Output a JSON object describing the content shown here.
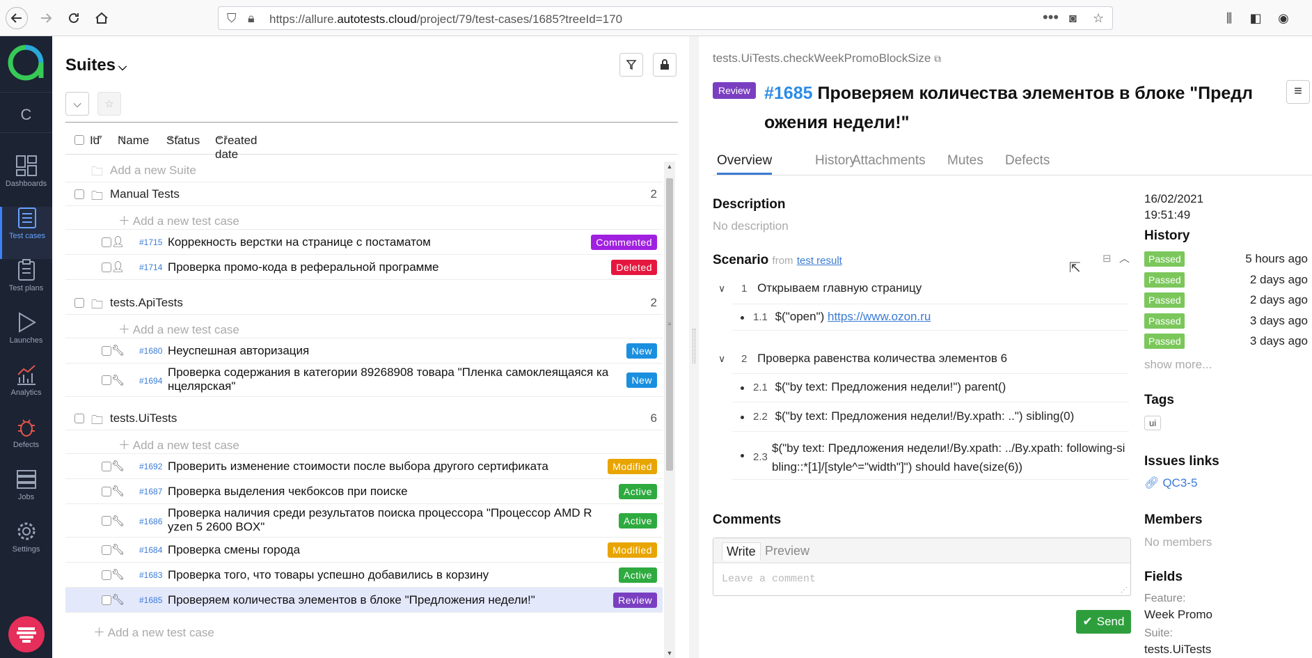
{
  "browser": {
    "url_prefix": "https://allure.",
    "url_host": "autotests.cloud",
    "url_suffix": "/project/79/test-cases/1685?treeId=170"
  },
  "nav": {
    "project_letter": "C",
    "items": [
      {
        "label": "Dashboards",
        "icon": "dashboards-icon"
      },
      {
        "label": "Test cases",
        "icon": "test-cases-icon"
      },
      {
        "label": "Test plans",
        "icon": "test-plans-icon"
      },
      {
        "label": "Launches",
        "icon": "launches-icon"
      },
      {
        "label": "Analytics",
        "icon": "analytics-icon"
      },
      {
        "label": "Defects",
        "icon": "defects-icon"
      },
      {
        "label": "Jobs",
        "icon": "jobs-icon"
      },
      {
        "label": "Settings",
        "icon": "settings-icon"
      }
    ],
    "active": "Test cases"
  },
  "left": {
    "title": "Suites",
    "columns": {
      "id": "Id",
      "name": "Name",
      "status": "Status",
      "created": "Created date"
    },
    "add_suite": "Add a new Suite",
    "add_case": "Add a new test case",
    "suites": [
      {
        "name": "Manual Tests",
        "count": "2",
        "cases": [
          {
            "id": "#1715",
            "name": "Коррекность верстки на странице с постаматом",
            "status": "Commented",
            "color": "#a020e0",
            "icon": "person-icon"
          },
          {
            "id": "#1714",
            "name": "Проверка промо-кода в реферальной программе",
            "status": "Deleted",
            "color": "#e5173e",
            "icon": "person-icon"
          }
        ]
      },
      {
        "name": "tests.ApiTests",
        "count": "2",
        "cases": [
          {
            "id": "#1680",
            "name": "Неуспешная авторизация",
            "status": "New",
            "color": "#1a8fe0",
            "icon": "wrench-icon"
          },
          {
            "id": "#1694",
            "name_l1": "Проверка содержания в категории 89268908 товара \"Пленка самоклеящаяся ка",
            "name_l2": "нцелярская\"",
            "status": "New",
            "color": "#1a8fe0",
            "icon": "wrench-icon"
          }
        ]
      },
      {
        "name": "tests.UiTests",
        "count": "6",
        "cases": [
          {
            "id": "#1692",
            "name": "Проверить изменение стоимости после выбора другого сертификата",
            "status": "Modified",
            "color": "#e8a400",
            "icon": "wrench-icon"
          },
          {
            "id": "#1687",
            "name": "Проверка выделения чекбоксов при поиске",
            "status": "Active",
            "color": "#2eaa3f",
            "icon": "wrench-icon"
          },
          {
            "id": "#1686",
            "name_l1": "Проверка наличия среди результатов поиска процессора \"Процессор AMD R",
            "name_l2": "yzen 5 2600 BOX\"",
            "status": "Active",
            "color": "#2eaa3f",
            "icon": "wrench-icon"
          },
          {
            "id": "#1684",
            "name": "Проверка смены города",
            "status": "Modified",
            "color": "#e8a400",
            "icon": "wrench-icon"
          },
          {
            "id": "#1683",
            "name": "Проверка того, что товары успешно добавились в корзину",
            "status": "Active",
            "color": "#2eaa3f",
            "icon": "wrench-icon"
          },
          {
            "id": "#1685",
            "name": "Проверяем количества элементов в блоке \"Предложения недели!\"",
            "status": "Review",
            "color": "#7a3fc1",
            "icon": "wrench-icon"
          }
        ]
      }
    ]
  },
  "detail": {
    "path": "tests.UiTests.checkWeekPromoBlockSize",
    "status_badge": "Review",
    "id": "#1685",
    "title_l1": "Проверяем количества элементов в блоке \"Предл",
    "title_l2": "ожения недели!\"",
    "tabs": [
      "Overview",
      "History",
      "Attachments",
      "Mutes",
      "Defects"
    ],
    "description_title": "Description",
    "description": "No description",
    "scenario_title": "Scenario",
    "scenario_from": "from",
    "scenario_link": "test result",
    "steps": [
      {
        "num": "1",
        "text": "Открываем главную страницу",
        "substeps": [
          {
            "num": "1.1",
            "text": "$(\"open\")",
            "link": "https://www.ozon.ru"
          }
        ]
      },
      {
        "num": "2",
        "text": "Проверка равенства количества элементов 6",
        "substeps": [
          {
            "num": "2.1",
            "text": "$(\"by text: Предложения недели!\") parent()"
          },
          {
            "num": "2.2",
            "text": "$(\"by text: Предложения недели!/By.xpath: ..\") sibling(0)"
          },
          {
            "num": "2.3",
            "text_l1": "$(\"by text: Предложения недели!/By.xpath: ../By.xpath: following-si",
            "text_l2": "bling::*[1]/[style^=\"width\"]\") should have(size(6))"
          }
        ]
      }
    ],
    "comments_title": "Comments",
    "comment_tabs": [
      "Write",
      "Preview"
    ],
    "comment_placeholder": "Leave a comment",
    "send_label": "Send"
  },
  "sidebar": {
    "date": "16/02/2021",
    "time": "19:51:49",
    "history_title": "History",
    "history": [
      {
        "status": "Passed",
        "when": "5 hours ago"
      },
      {
        "status": "Passed",
        "when": "2 days ago"
      },
      {
        "status": "Passed",
        "when": "2 days ago"
      },
      {
        "status": "Passed",
        "when": "3 days ago"
      },
      {
        "status": "Passed",
        "when": "3 days ago"
      }
    ],
    "show_more": "show more...",
    "tags_title": "Tags",
    "tags": [
      "ui"
    ],
    "issues_title": "Issues links",
    "issue": "QC3-5",
    "members_title": "Members",
    "members": "No members",
    "fields_title": "Fields",
    "fields": [
      {
        "label": "Feature:",
        "value": "Week Promo"
      },
      {
        "label": "Suite:",
        "value": "tests.UiTests"
      }
    ]
  },
  "colors": {
    "nav_bg": "#1c2333",
    "accent": "#3a7bd5",
    "passed": "#7bc75b",
    "review": "#7a3fc1"
  }
}
